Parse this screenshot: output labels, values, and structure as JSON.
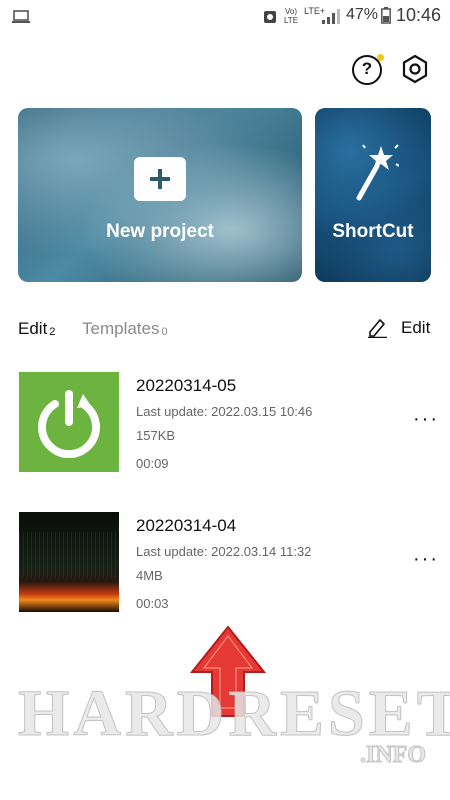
{
  "status_bar": {
    "volte": "Vo) LTE",
    "network": "LTE+",
    "battery": "47%",
    "time": "10:46"
  },
  "header": {
    "help_icon": "question-circle-icon",
    "settings_icon": "hexagon-gear-icon"
  },
  "cards": {
    "new_project_label": "New project",
    "shortcut_label": "ShortCut"
  },
  "tabs": {
    "edit_label": "Edit",
    "edit_count": "2",
    "templates_label": "Templates",
    "templates_count": "0",
    "edit_action_label": "Edit"
  },
  "projects": [
    {
      "name": "20220314-05",
      "last_update": "Last update: 2022.03.15 10:46",
      "size": "157KB",
      "duration": "00:09"
    },
    {
      "name": "20220314-04",
      "last_update": "Last update: 2022.03.14 11:32",
      "size": "4MB",
      "duration": "00:03"
    }
  ],
  "more_label": "···",
  "watermark": {
    "main": "HARDRESET",
    "sub": ".INFO"
  },
  "colors": {
    "accent_dot": "#f5c518",
    "power_thumb_green": "#6db33f",
    "arrow_red": "#e53935"
  }
}
